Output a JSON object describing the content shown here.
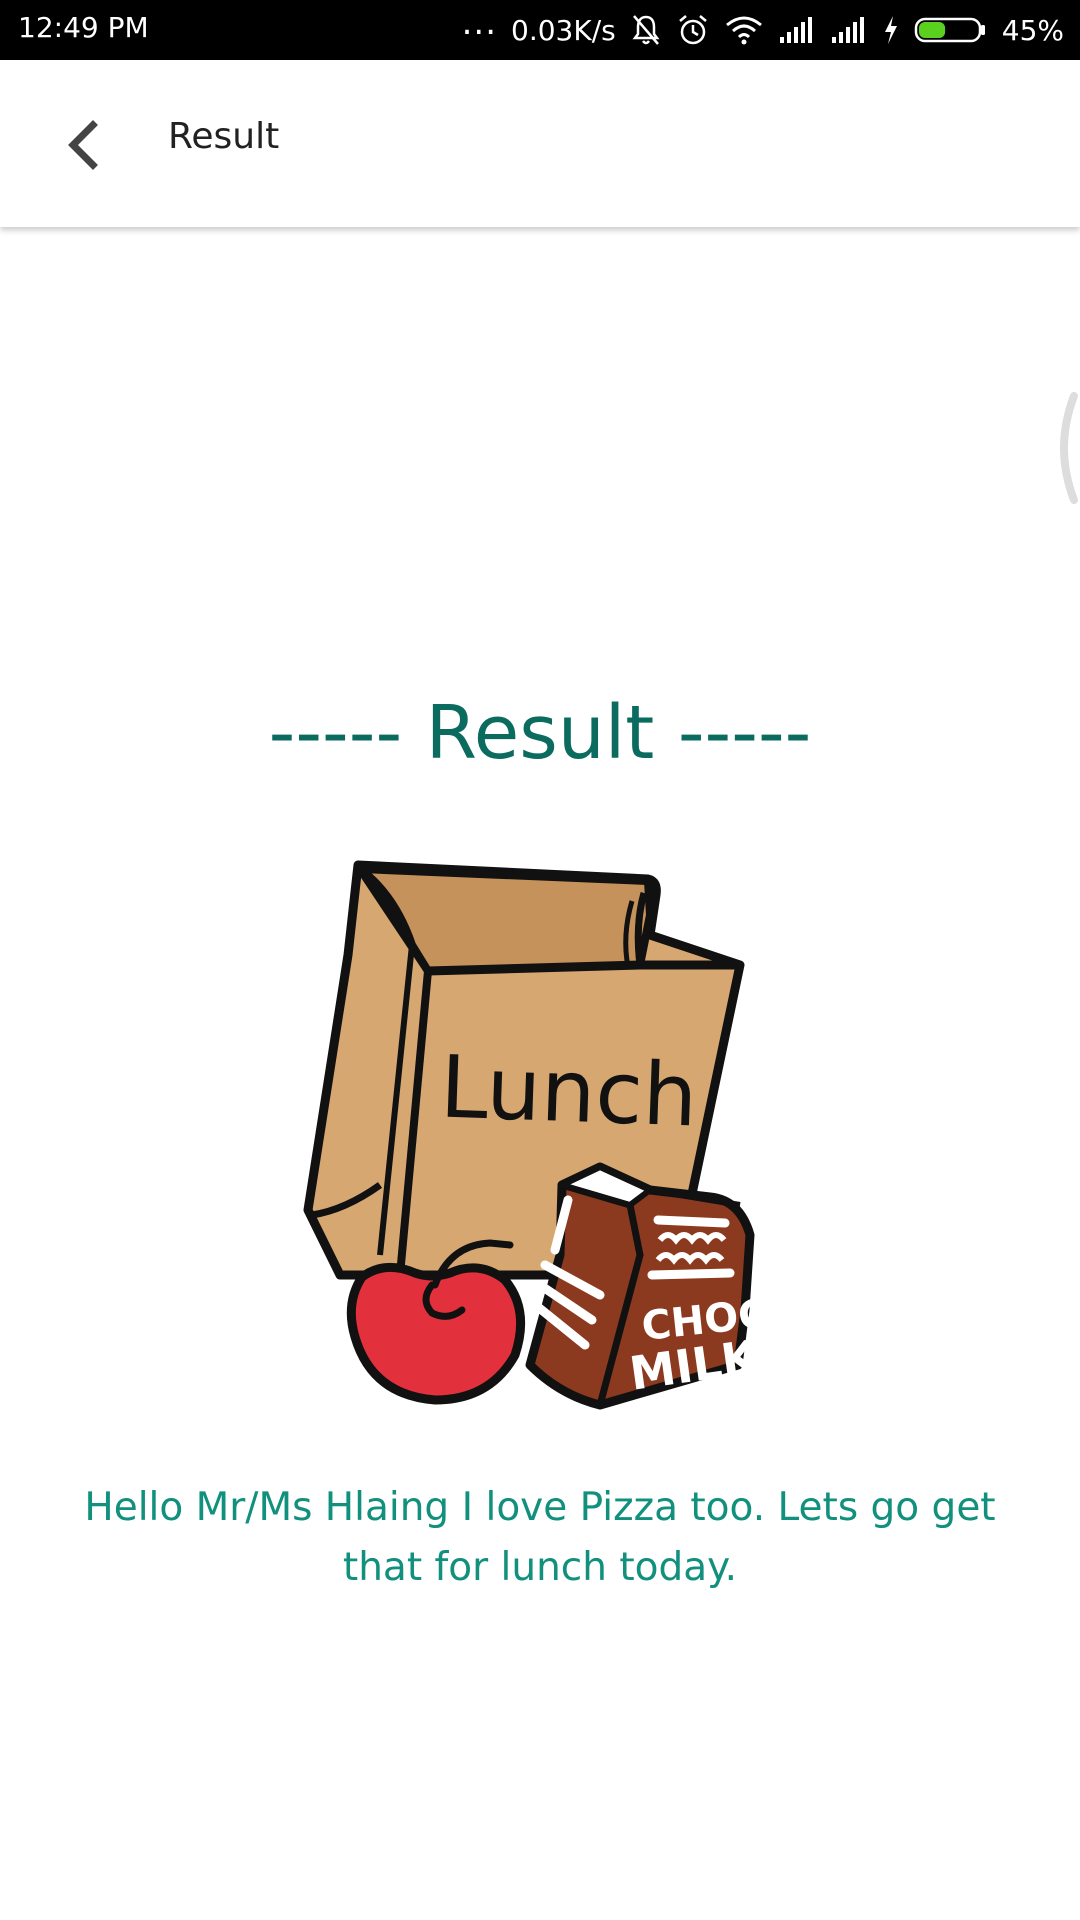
{
  "status_bar": {
    "time": "12:49 PM",
    "dots": "...",
    "net_speed": "0.03K/s",
    "battery_percent": "45%",
    "battery_level": 0.45,
    "icons": [
      "mute-bell-icon",
      "alarm-icon",
      "wifi-icon",
      "signal-icon",
      "signal-icon",
      "charging-icon",
      "battery-icon"
    ]
  },
  "app_bar": {
    "back_icon": "chevron-left-icon",
    "title": "Result"
  },
  "content": {
    "heading": "----- Result -----",
    "illustration": {
      "icon": "lunch-bag-illustration",
      "bag_label": "Lunch",
      "carton_label_line1": "CHOCO",
      "carton_label_line2": "MILK"
    },
    "message": "Hello Mr/Ms Hlaing I love Pizza too. Lets go get that for lunch today."
  },
  "colors": {
    "heading": "#0b6b5e",
    "message": "#11907e",
    "bag": "#d7a772",
    "bag_inside": "#c4925a",
    "apple": "#e2313d",
    "carton": "#8c3a1f"
  }
}
